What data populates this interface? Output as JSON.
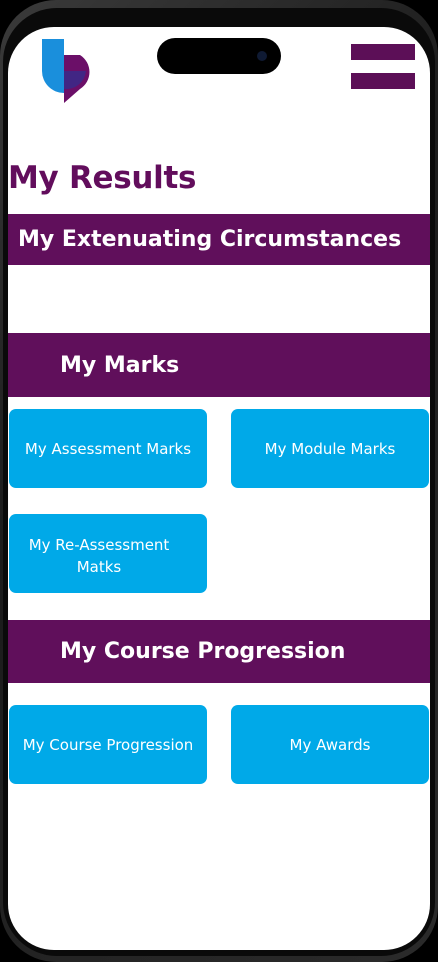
{
  "header": {
    "logo_icon": "university-logo-icon",
    "menu_icon": "hamburger-menu-icon"
  },
  "colors": {
    "brand_purple": "#600f5b",
    "tile_blue": "#00a9e8",
    "logo_blue": "#1a8fdc"
  },
  "page": {
    "title": "My Results"
  },
  "sections": {
    "extenuating": {
      "label": "My Extenuating Circumstances"
    },
    "marks": {
      "label": "My Marks",
      "tiles": {
        "assessment": "My Assessment Marks",
        "module": "My Module Marks",
        "reassessment": "My Re-Assessment Matks"
      }
    },
    "progression": {
      "label": "My Course Progression",
      "tiles": {
        "course": "My Course Progression",
        "awards": "My Awards"
      }
    }
  }
}
